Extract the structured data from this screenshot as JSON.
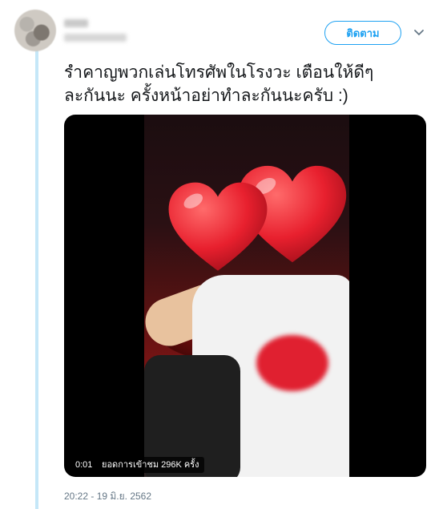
{
  "tweet": {
    "follow_label": "ติดตาม",
    "text_line1": "รำคาญพวกเล่นโทรศัพในโรงวะ เตือนให้ดีๆ",
    "text_line2": "ละกันนะ ครั้งหน้าอย่าทำละกันนะครับ :)",
    "timestamp": "20:22 - 19 มิ.ย. 2562"
  },
  "video": {
    "time": "0:01",
    "views_label": "ยอดการเข้าชม 296K ครั้ง"
  },
  "colors": {
    "accent": "#1da1f2",
    "thread_line": "#c5e7f8",
    "heart": "#e8202e"
  }
}
